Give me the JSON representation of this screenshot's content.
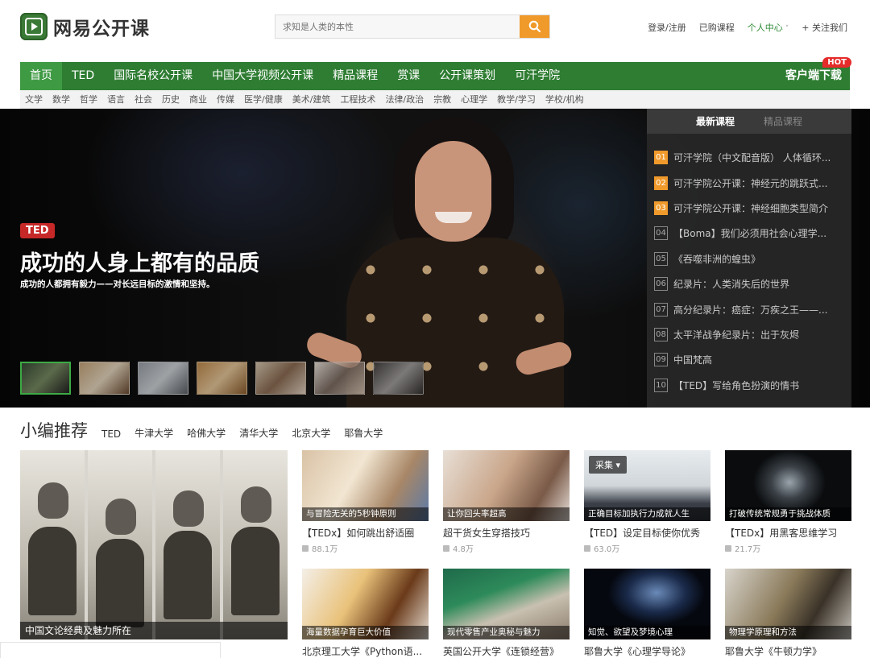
{
  "brand": {
    "name": "网易公开课"
  },
  "search": {
    "placeholder": "求知是人类的本性"
  },
  "toplinks": [
    "登录/注册",
    "已购课程",
    "个人中心",
    "+ 关注我们"
  ],
  "mainnav": {
    "items": [
      "首页",
      "TED",
      "国际名校公开课",
      "中国大学视频公开课",
      "精品课程",
      "赏课",
      "公开课策划",
      "可汗学院"
    ],
    "client": "客户端下载",
    "hot": "HOT"
  },
  "subnav": [
    "文学",
    "数学",
    "哲学",
    "语言",
    "社会",
    "历史",
    "商业",
    "传媒",
    "医学/健康",
    "美术/建筑",
    "工程技术",
    "法律/政治",
    "宗教",
    "心理学",
    "教学/学习",
    "学校/机构"
  ],
  "hero": {
    "badge": "TED",
    "title": "成功的人身上都有的品质",
    "subtitle": "成功的人都拥有毅力——对长远目标的激情和坚持。"
  },
  "panel": {
    "tabs": [
      "最新课程",
      "精品课程"
    ],
    "items": [
      {
        "num": "01",
        "text": "可汗学院（中文配音版） 人体循环..."
      },
      {
        "num": "02",
        "text": "可汗学院公开课：神经元的跳跃式..."
      },
      {
        "num": "03",
        "text": "可汗学院公开课：神经细胞类型简介"
      },
      {
        "num": "04",
        "text": "【Boma】我们必须用社会心理学..."
      },
      {
        "num": "05",
        "text": "《吞噬非洲的蝗虫》"
      },
      {
        "num": "06",
        "text": "纪录片：人类消失后的世界"
      },
      {
        "num": "07",
        "text": "高分纪录片：癌症：万疾之王——..."
      },
      {
        "num": "08",
        "text": "太平洋战争纪录片：出于灰烬"
      },
      {
        "num": "09",
        "text": "中国梵高"
      },
      {
        "num": "10",
        "text": "【TED】写给角色扮演的情书"
      }
    ]
  },
  "recommend": {
    "title": "小编推荐",
    "tags": [
      "TED",
      "牛津大学",
      "哈佛大学",
      "清华大学",
      "北京大学",
      "耶鲁大学"
    ],
    "big": {
      "caption": "中国文论经典及魅力所在"
    },
    "collect": "采集 ▾",
    "cards": [
      {
        "caption": "与冒险无关的5秒钟原则",
        "title": "【TEDx】如何跳出舒适圈",
        "views": "88.1万"
      },
      {
        "caption": "让你回头率超高",
        "title": "超干货女生穿搭技巧",
        "views": "4.8万"
      },
      {
        "caption": "正确目标加执行力成就人生",
        "title": "【TED】设定目标使你优秀",
        "views": "63.0万"
      },
      {
        "caption": "打破传统常规勇于挑战体质",
        "title": "【TEDx】用黑客思维学习",
        "views": "21.7万"
      },
      {
        "caption": "海量数据孕育巨大价值",
        "title": "北京理工大学《Python语...",
        "views": ""
      },
      {
        "caption": "现代零售产业奥秘与魅力",
        "title": "英国公开大学《连锁经营》",
        "views": ""
      },
      {
        "caption": "知觉、欲望及梦境心理",
        "title": "耶鲁大学《心理学导论》",
        "views": ""
      },
      {
        "caption": "物理学原理和方法",
        "title": "耶鲁大学《牛顿力学》",
        "views": ""
      }
    ]
  },
  "colors": {
    "brand_green": "#2e7d32",
    "accent_orange": "#f09a2b",
    "hot_red": "#e62b2b"
  }
}
